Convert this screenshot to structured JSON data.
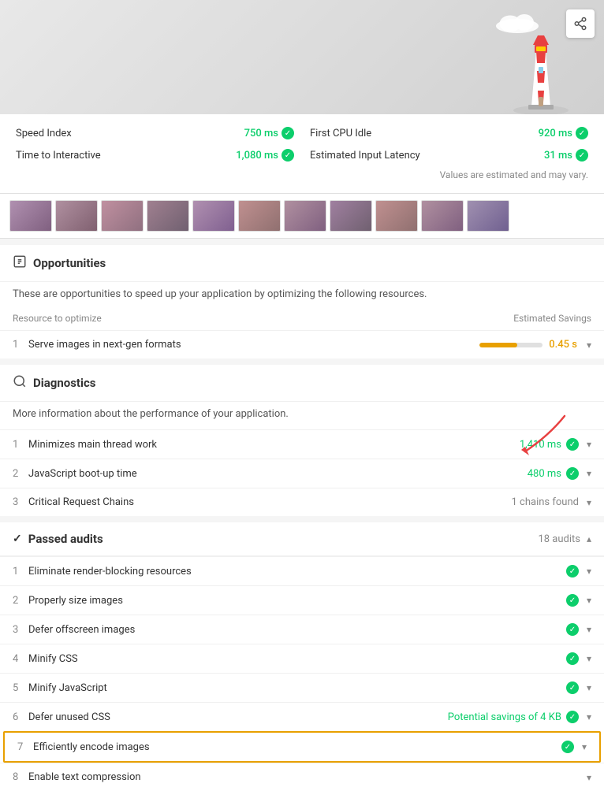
{
  "header": {
    "share_label": "Share"
  },
  "metrics": {
    "speed_index_label": "Speed Index",
    "speed_index_value": "750 ms",
    "first_cpu_label": "First CPU Idle",
    "first_cpu_value": "920 ms",
    "tti_label": "Time to Interactive",
    "tti_value": "1,080 ms",
    "input_latency_label": "Estimated Input Latency",
    "input_latency_value": "31 ms",
    "estimated_note": "Values are estimated and may vary."
  },
  "opportunities": {
    "title": "Opportunities",
    "description": "These are opportunities to speed up your application by optimizing the following resources.",
    "col_resource": "Resource to optimize",
    "col_savings": "Estimated Savings",
    "items": [
      {
        "num": "1",
        "label": "Serve images in next-gen formats",
        "savings_bar_pct": 60,
        "savings_text": "0.45 s"
      }
    ]
  },
  "diagnostics": {
    "title": "Diagnostics",
    "description": "More information about the performance of your application.",
    "items": [
      {
        "num": "1",
        "label": "Minimizes main thread work",
        "value": "1,410 ms",
        "type": "green"
      },
      {
        "num": "2",
        "label": "JavaScript boot-up time",
        "value": "480 ms",
        "type": "green"
      },
      {
        "num": "3",
        "label": "Critical Request Chains",
        "value": "1 chains found",
        "type": "gray"
      }
    ]
  },
  "passed": {
    "title": "Passed audits",
    "count": "18 audits",
    "items": [
      {
        "num": "1",
        "label": "Eliminate render-blocking resources",
        "value": "",
        "type": "green"
      },
      {
        "num": "2",
        "label": "Properly size images",
        "value": "",
        "type": "green"
      },
      {
        "num": "3",
        "label": "Defer offscreen images",
        "value": "",
        "type": "green"
      },
      {
        "num": "4",
        "label": "Minify CSS",
        "value": "",
        "type": "green"
      },
      {
        "num": "5",
        "label": "Minify JavaScript",
        "value": "",
        "type": "green"
      },
      {
        "num": "6",
        "label": "Defer unused CSS",
        "value": "Potential savings of 4 KB",
        "type": "green-text"
      },
      {
        "num": "7",
        "label": "Efficiently encode images",
        "value": "",
        "type": "green",
        "highlighted": true
      },
      {
        "num": "8",
        "label": "Enable text compression",
        "value": "",
        "type": "none"
      }
    ]
  },
  "colors": {
    "green": "#0cce6b",
    "orange": "#e8a000",
    "gray": "#888888",
    "border": "#e0e0e0"
  }
}
